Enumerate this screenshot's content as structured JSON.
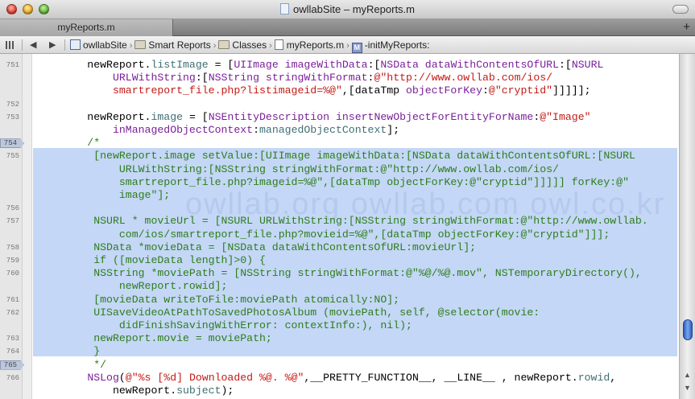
{
  "window": {
    "title": "owllabSite – myReports.m"
  },
  "tab": {
    "label": "myReports.m",
    "add_label": "+"
  },
  "jumpbar": {
    "back_label": "◀",
    "forward_label": "▶",
    "path": [
      "owllabSite",
      "Smart Reports",
      "Classes",
      "myReports.m",
      "-initMyReports:"
    ],
    "method_badge": "M"
  },
  "watermark": "owllab.org  owllab.com  owl.co.kr",
  "breakpoints": [
    "754",
    "765"
  ],
  "lines": [
    {
      "num": "751",
      "row": 0,
      "parts": [
        {
          "t": "        newReport.",
          "c": ""
        },
        {
          "t": "listImage",
          "c": "p"
        },
        {
          "t": " = [",
          "c": ""
        },
        {
          "t": "UIImage",
          "c": "k"
        },
        {
          "t": " ",
          "c": ""
        },
        {
          "t": "imageWithData",
          "c": "k"
        },
        {
          "t": ":[",
          "c": ""
        },
        {
          "t": "NSData",
          "c": "k"
        },
        {
          "t": " ",
          "c": ""
        },
        {
          "t": "dataWithContentsOfURL",
          "c": "k"
        },
        {
          "t": ":[",
          "c": ""
        },
        {
          "t": "NSURL",
          "c": "k"
        }
      ]
    },
    {
      "num": "",
      "row": 1,
      "parts": [
        {
          "t": "            ",
          "c": ""
        },
        {
          "t": "URLWithString",
          "c": "k"
        },
        {
          "t": ":[",
          "c": ""
        },
        {
          "t": "NSString",
          "c": "k"
        },
        {
          "t": " ",
          "c": ""
        },
        {
          "t": "stringWithFormat",
          "c": "k"
        },
        {
          "t": ":",
          "c": ""
        },
        {
          "t": "@\"http://www.owllab.com/ios/",
          "c": "s"
        }
      ]
    },
    {
      "num": "",
      "row": 2,
      "parts": [
        {
          "t": "            ",
          "c": ""
        },
        {
          "t": "smartreport_file.php?listimageid=%@\"",
          "c": "s"
        },
        {
          "t": ",[dataTmp ",
          "c": ""
        },
        {
          "t": "objectForKey",
          "c": "k"
        },
        {
          "t": ":",
          "c": ""
        },
        {
          "t": "@\"cryptid\"",
          "c": "s"
        },
        {
          "t": "]]]]];",
          "c": ""
        }
      ]
    },
    {
      "num": "752",
      "row": 3,
      "parts": []
    },
    {
      "num": "753",
      "row": 4,
      "parts": [
        {
          "t": "        newReport.",
          "c": ""
        },
        {
          "t": "image",
          "c": "p"
        },
        {
          "t": " = [",
          "c": ""
        },
        {
          "t": "NSEntityDescription",
          "c": "k"
        },
        {
          "t": " ",
          "c": ""
        },
        {
          "t": "insertNewObjectForEntityForName",
          "c": "k"
        },
        {
          "t": ":",
          "c": ""
        },
        {
          "t": "@\"Image\"",
          "c": "s"
        }
      ]
    },
    {
      "num": "",
      "row": 5,
      "parts": [
        {
          "t": "            ",
          "c": ""
        },
        {
          "t": "inManagedObjectContext",
          "c": "k"
        },
        {
          "t": ":",
          "c": ""
        },
        {
          "t": "managedObjectContext",
          "c": "p"
        },
        {
          "t": "];",
          "c": ""
        }
      ]
    },
    {
      "num": "754",
      "row": 6,
      "parts": [
        {
          "t": "        /*",
          "c": "c"
        }
      ]
    },
    {
      "num": "755",
      "row": 7,
      "parts": [
        {
          "t": "         [newReport.image setValue:[UIImage imageWithData:[NSData dataWithContentsOfURL:[NSURL",
          "c": "c"
        }
      ]
    },
    {
      "num": "",
      "row": 8,
      "parts": [
        {
          "t": "             URLWithString:[NSString stringWithFormat:@\"http://www.owllab.com/ios/",
          "c": "c"
        }
      ]
    },
    {
      "num": "",
      "row": 9,
      "parts": [
        {
          "t": "             smartreport_file.php?imageid=%@\",[dataTmp objectForKey:@\"cryptid\"]]]]] forKey:@\"",
          "c": "c"
        }
      ]
    },
    {
      "num": "",
      "row": 10,
      "parts": [
        {
          "t": "             image\"];",
          "c": "c"
        }
      ]
    },
    {
      "num": "756",
      "row": 11,
      "parts": []
    },
    {
      "num": "757",
      "row": 12,
      "parts": [
        {
          "t": "         NSURL * movieUrl = [NSURL URLWithString:[NSString stringWithFormat:@\"http://www.owllab.",
          "c": "c"
        }
      ]
    },
    {
      "num": "",
      "row": 13,
      "parts": [
        {
          "t": "             com/ios/smartreport_file.php?movieid=%@\",[dataTmp objectForKey:@\"cryptid\"]]];",
          "c": "c"
        }
      ]
    },
    {
      "num": "758",
      "row": 14,
      "parts": [
        {
          "t": "         NSData *movieData = [NSData dataWithContentsOfURL:movieUrl];",
          "c": "c"
        }
      ]
    },
    {
      "num": "759",
      "row": 15,
      "parts": [
        {
          "t": "         if ([movieData length]>0) {",
          "c": "c"
        }
      ]
    },
    {
      "num": "760",
      "row": 16,
      "parts": [
        {
          "t": "         NSString *moviePath = [NSString stringWithFormat:@\"%@/%@.mov\", NSTemporaryDirectory(),",
          "c": "c"
        }
      ]
    },
    {
      "num": "",
      "row": 17,
      "parts": [
        {
          "t": "             newReport.rowid];",
          "c": "c"
        }
      ]
    },
    {
      "num": "761",
      "row": 18,
      "parts": [
        {
          "t": "         [movieData writeToFile:moviePath atomically:NO];",
          "c": "c"
        }
      ]
    },
    {
      "num": "762",
      "row": 19,
      "parts": [
        {
          "t": "         UISaveVideoAtPathToSavedPhotosAlbum (moviePath, self, @selector(movie:",
          "c": "c"
        }
      ]
    },
    {
      "num": "",
      "row": 20,
      "parts": [
        {
          "t": "             didFinishSavingWithError: contextInfo:), nil);",
          "c": "c"
        }
      ]
    },
    {
      "num": "763",
      "row": 21,
      "parts": [
        {
          "t": "         newReport.movie = moviePath;",
          "c": "c"
        }
      ]
    },
    {
      "num": "764",
      "row": 22,
      "parts": [
        {
          "t": "         }",
          "c": "c"
        }
      ]
    },
    {
      "num": "765",
      "row": 23,
      "parts": [
        {
          "t": "         */",
          "c": "c"
        }
      ]
    },
    {
      "num": "766",
      "row": 24,
      "parts": [
        {
          "t": "        ",
          "c": ""
        },
        {
          "t": "NSLog",
          "c": "k"
        },
        {
          "t": "(",
          "c": ""
        },
        {
          "t": "@\"%s [%d] Downloaded %@. %@\"",
          "c": "s"
        },
        {
          "t": ",__PRETTY_FUNCTION__, __LINE__ , newReport.",
          "c": ""
        },
        {
          "t": "rowid",
          "c": "p"
        },
        {
          "t": ",",
          "c": ""
        }
      ]
    },
    {
      "num": "",
      "row": 25,
      "parts": [
        {
          "t": "            newReport.",
          "c": ""
        },
        {
          "t": "subject",
          "c": "p"
        },
        {
          "t": ");",
          "c": ""
        }
      ]
    }
  ]
}
